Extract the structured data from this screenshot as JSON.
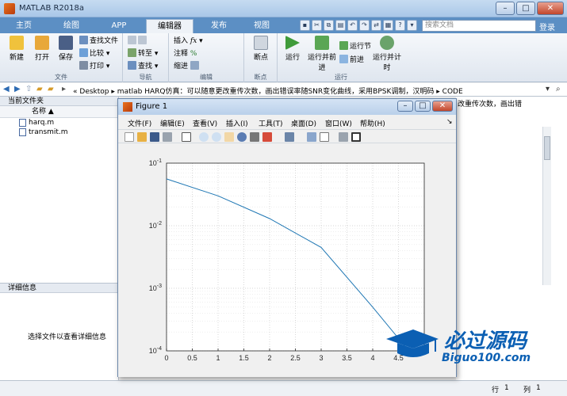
{
  "window": {
    "title": "MATLAB R2018a"
  },
  "tabs": [
    {
      "label": "主页"
    },
    {
      "label": "绘图"
    },
    {
      "label": "APP"
    },
    {
      "label": "编辑器"
    },
    {
      "label": "发布"
    },
    {
      "label": "视图"
    }
  ],
  "search": {
    "placeholder": "搜索文档"
  },
  "login": "登录",
  "ribbon": {
    "file": {
      "label": "文件",
      "new": "新建",
      "open": "打开",
      "save": "保存",
      "find_files": "查找文件",
      "compare": "比较",
      "print": "打印"
    },
    "nav": {
      "label": "导航",
      "goto": "转至",
      "find": "查找"
    },
    "edit": {
      "label": "编辑",
      "insert": "插入",
      "comment": "注释",
      "indent": "缩进"
    },
    "breakpoints": {
      "label": "断点",
      "bp": "断点"
    },
    "run": {
      "label": "运行",
      "run": "运行",
      "run_advance": "运行并前进",
      "run_section": "运行节",
      "advance": "前进",
      "run_time": "运行并计时"
    }
  },
  "address": {
    "segments": [
      "«",
      "Desktop",
      "▸",
      "matlab HARQ仿真：可以随意更改重传次数，画出错误率随SNR变化曲线，采用BPSK调制，汉明码",
      "▸",
      "CODE"
    ]
  },
  "current_folder": {
    "title": "当前文件夹",
    "col_name": "名称 ▲",
    "files": [
      "harq.m",
      "transmit.m"
    ]
  },
  "details": {
    "title": "详细信息",
    "hint": "选择文件以查看详细信息"
  },
  "right_fragment": "改重传次数，画出错",
  "status": {
    "line_label": "行",
    "line": "1",
    "col_label": "列",
    "col": "1"
  },
  "figure": {
    "title": "Figure 1",
    "menu": [
      "文件(F)",
      "编辑(E)",
      "查看(V)",
      "插入(I)",
      "工具(T)",
      "桌面(D)",
      "窗口(W)",
      "帮助(H)"
    ]
  },
  "watermark": {
    "text": "必过源码",
    "sub": "Biguo100.com"
  },
  "chart_data": {
    "type": "line",
    "title": "",
    "xlabel": "",
    "ylabel": "",
    "xlim": [
      0,
      5
    ],
    "ylim": [
      0.0001,
      0.1
    ],
    "y_scale": "log",
    "grid": true,
    "x_ticks": [
      "0",
      "0.5",
      "1",
      "1.5",
      "2",
      "2.5",
      "3",
      "3.5",
      "4",
      "4.5"
    ],
    "series": [
      {
        "x": [
          0,
          1,
          2,
          3,
          4,
          4.7
        ],
        "y": [
          0.056,
          0.03,
          0.013,
          0.0045,
          0.0005,
          0.0001
        ],
        "color": "#1f77b4"
      }
    ]
  }
}
